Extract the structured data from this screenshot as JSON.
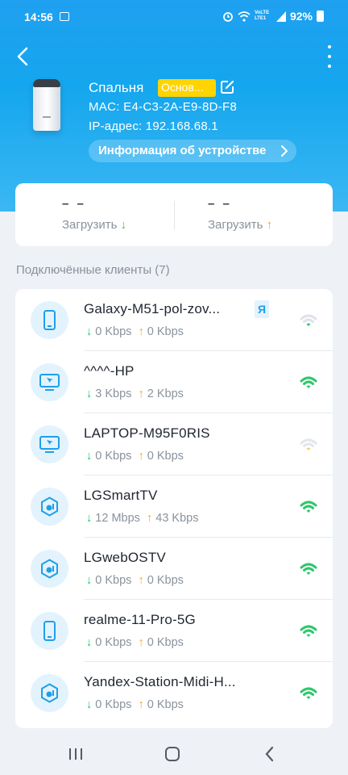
{
  "status_bar": {
    "time": "14:56",
    "network": "VoLTE LTE1",
    "battery": "92%"
  },
  "device": {
    "name": "Спальня",
    "badge": "Основ...",
    "mac": "MAC: E4-C3-2A-E9-8D-F8",
    "ip": "IP-адрес: 192.168.68.1",
    "info_button": "Информация об устройстве"
  },
  "stats": [
    {
      "value": "– –",
      "label": "Загрузить",
      "arrow": "↓"
    },
    {
      "value": "– –",
      "label": "Загрузить",
      "arrow": "↑"
    }
  ],
  "section_title": "Подключённые клиенты (7)",
  "clients": [
    {
      "name": "Galaxy-M51-pol-zov...",
      "tag": "Я",
      "icon": "phone-icon",
      "down": "0 Kbps",
      "up": "0 Kbps",
      "signal": "weak"
    },
    {
      "name": "^^^^-HP",
      "icon": "desktop-icon",
      "down": "3 Kbps",
      "up": "2 Kbps",
      "signal": "strong"
    },
    {
      "name": "LAPTOP-M95F0RIS",
      "icon": "desktop-icon",
      "down": "0 Kbps",
      "up": "0 Kbps",
      "signal": "faint"
    },
    {
      "name": "LGSmartTV",
      "icon": "iot-device-icon",
      "down": "12 Mbps",
      "up": "43 Kbps",
      "signal": "strong"
    },
    {
      "name": "LGwebOSTV",
      "icon": "iot-device-icon",
      "down": "0 Kbps",
      "up": "0 Kbps",
      "signal": "strong"
    },
    {
      "name": "realme-11-Pro-5G",
      "icon": "phone-icon",
      "down": "0 Kbps",
      "up": "0 Kbps",
      "signal": "strong"
    },
    {
      "name": "Yandex-Station-Midi-H...",
      "icon": "iot-device-icon",
      "down": "0 Kbps",
      "up": "0 Kbps",
      "signal": "strong"
    }
  ],
  "colors": {
    "header": "#14a6ee",
    "download": "#2ec86b",
    "upload": "#f5a623",
    "badge": "#ffd400",
    "accent": "#1f9fe8"
  }
}
